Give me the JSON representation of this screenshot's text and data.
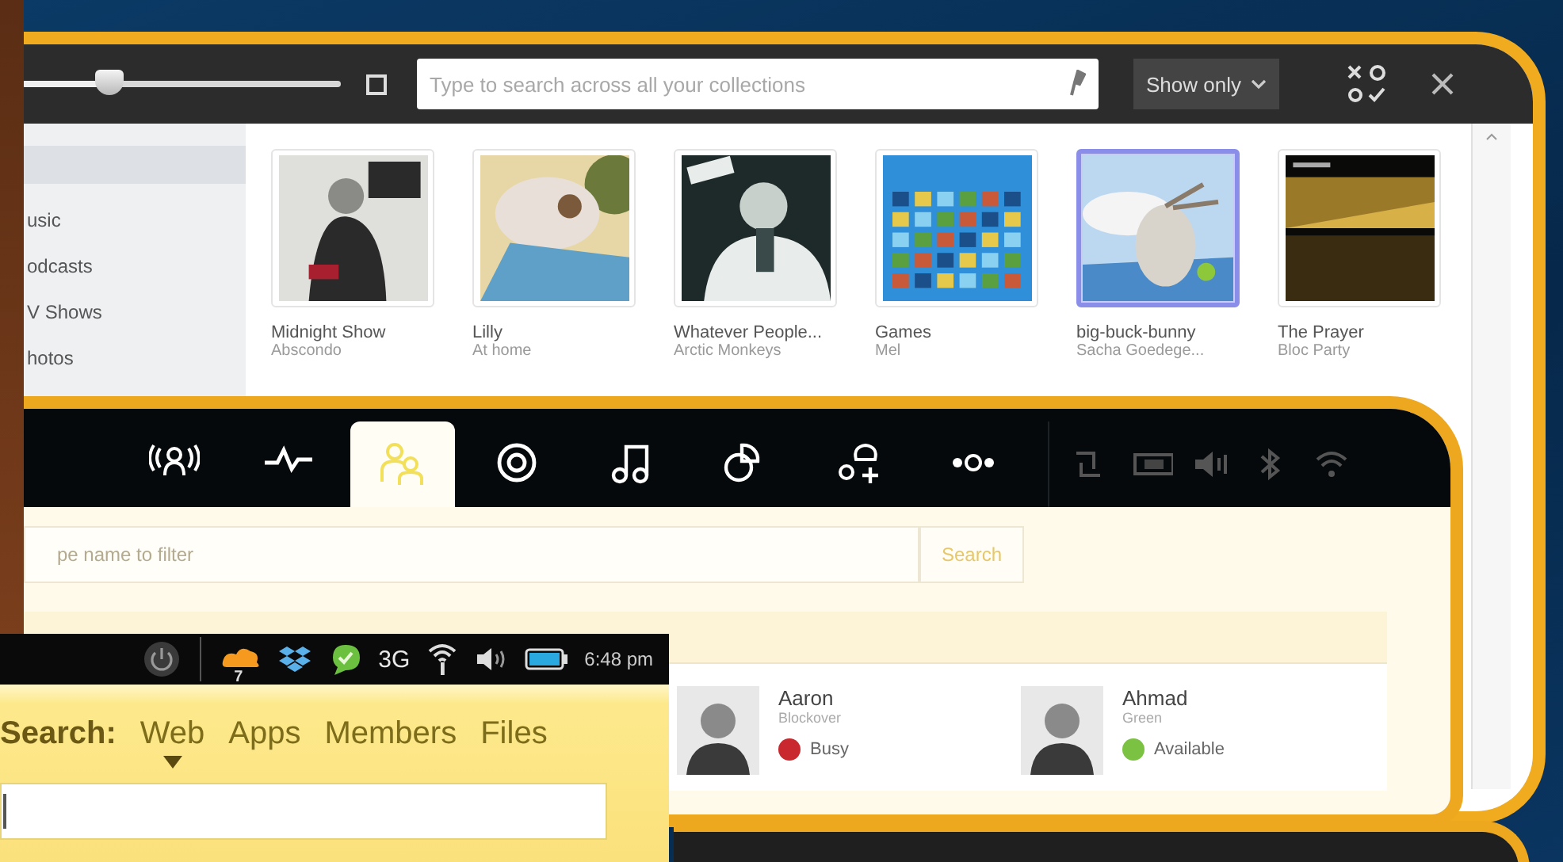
{
  "media_window": {
    "zoom_slider": {
      "level": 0.27
    },
    "grid_toggle": {
      "checked": false
    },
    "search": {
      "placeholder": "Type to search across all your collections"
    },
    "show_only": "Show only",
    "sidebar": {
      "items": [
        {
          "label": "usic"
        },
        {
          "label": "odcasts"
        },
        {
          "label": "V Shows"
        },
        {
          "label": "hotos"
        }
      ]
    },
    "albums": [
      {
        "title": "Midnight Show",
        "artist": "Abscondo",
        "selected": false
      },
      {
        "title": "Lilly",
        "artist": "At home",
        "selected": false
      },
      {
        "title": "Whatever People...",
        "artist": "Arctic Monkeys",
        "selected": false
      },
      {
        "title": "Games",
        "artist": "Mel",
        "selected": false
      },
      {
        "title": "big-buck-bunny",
        "artist": "Sacha Goedege...",
        "selected": true
      },
      {
        "title": "The Prayer",
        "artist": "Bloc Party",
        "selected": false
      }
    ]
  },
  "chat_window": {
    "tabs": [
      {
        "selected": false
      },
      {
        "selected": false
      },
      {
        "selected": true
      },
      {
        "selected": false
      },
      {
        "selected": false
      },
      {
        "selected": false
      },
      {
        "selected": false
      },
      {
        "selected": false
      }
    ],
    "filter": {
      "placeholder": "pe name to filter"
    },
    "search_button": "Search",
    "contacts": [
      {
        "name": "Aaron",
        "subtitle": "Blockover",
        "status": "Busy",
        "color": "#c8282e"
      },
      {
        "name": "Ahmad",
        "subtitle": "Green",
        "status": "Available",
        "color": "#7cc242"
      }
    ]
  },
  "phone": {
    "status_bar": {
      "notification_count": "7",
      "network": "3G",
      "time": "6:48 pm"
    },
    "search": {
      "label": "Search:",
      "scopes": [
        {
          "label": "Web",
          "selected": true
        },
        {
          "label": "Apps",
          "selected": false
        },
        {
          "label": "Members",
          "selected": false
        },
        {
          "label": "Files",
          "selected": false
        }
      ]
    }
  }
}
